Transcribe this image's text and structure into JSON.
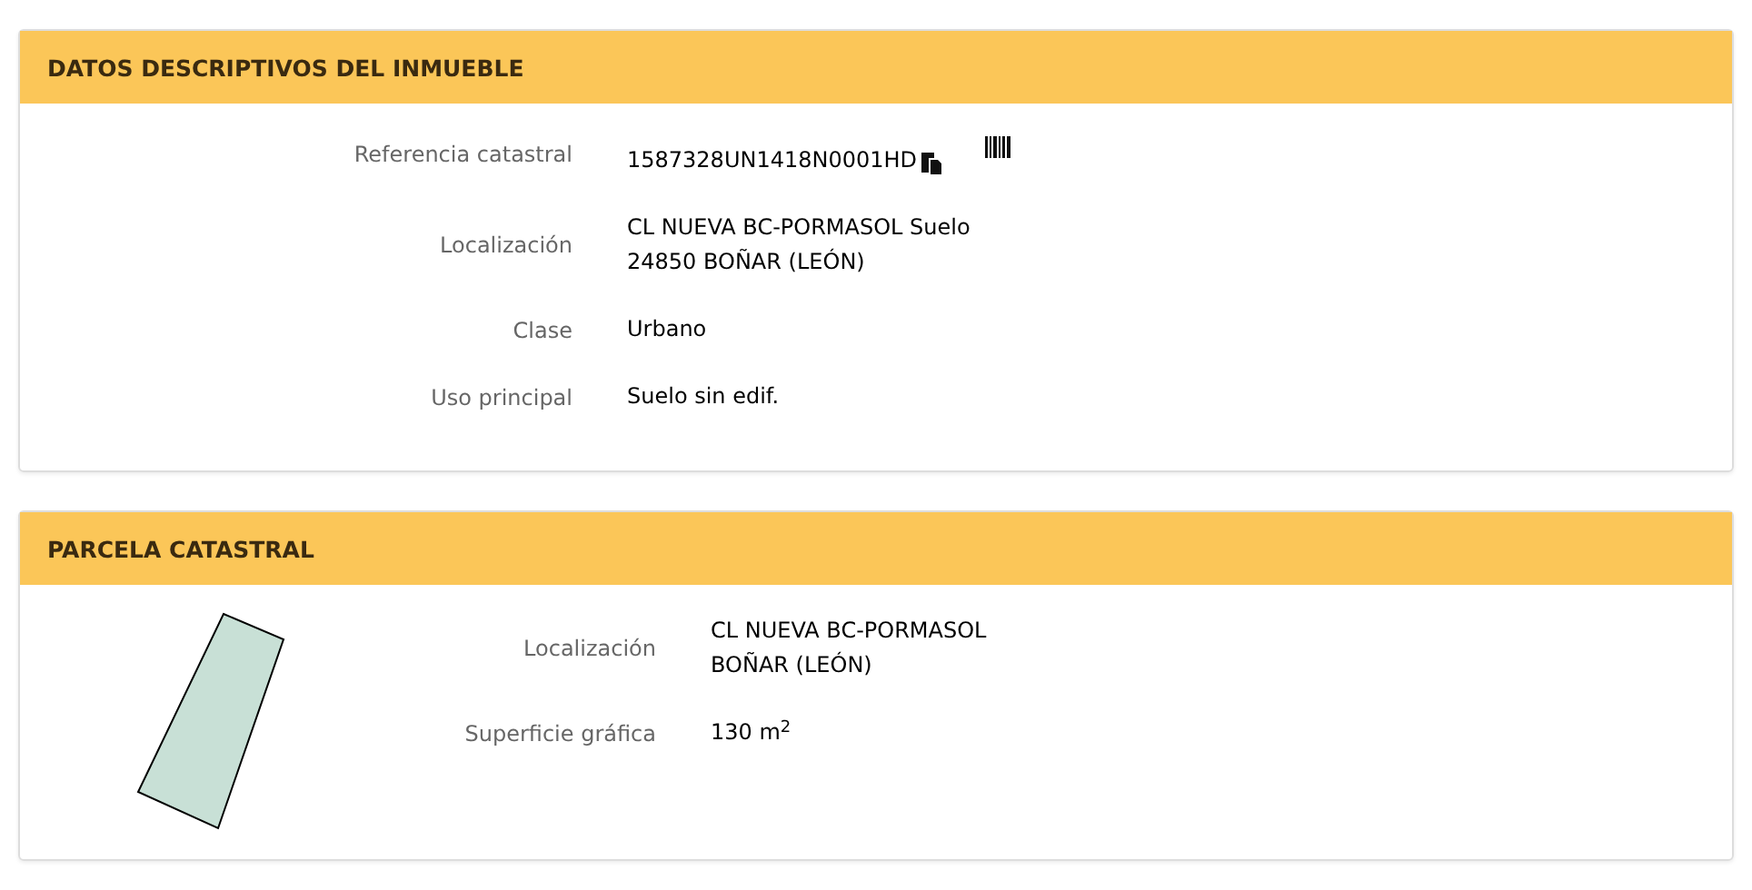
{
  "panels": [
    {
      "title": "DATOS DESCRIPTIVOS DEL INMUEBLE",
      "kind": "info",
      "fields": [
        {
          "label": "Referencia catastral",
          "lines": [
            "1587328UN1418N0001HD"
          ],
          "actions": true
        },
        {
          "label": "Localización",
          "lines": [
            "CL NUEVA BC-PORMASOL Suelo",
            "24850 BOÑAR (LEÓN)"
          ]
        },
        {
          "label": "Clase",
          "lines": [
            "Urbano"
          ]
        },
        {
          "label": "Uso principal",
          "lines": [
            "Suelo sin edif."
          ]
        }
      ]
    },
    {
      "title": "PARCELA CATASTRAL",
      "kind": "parcel",
      "fields": [
        {
          "label": "Localización",
          "lines": [
            "CL NUEVA BC-PORMASOL",
            "BOÑAR (LEÓN)"
          ]
        },
        {
          "label": "Superficie gráfica",
          "lines": [
            "130 m$^{2}$"
          ]
        }
      ]
    }
  ]
}
